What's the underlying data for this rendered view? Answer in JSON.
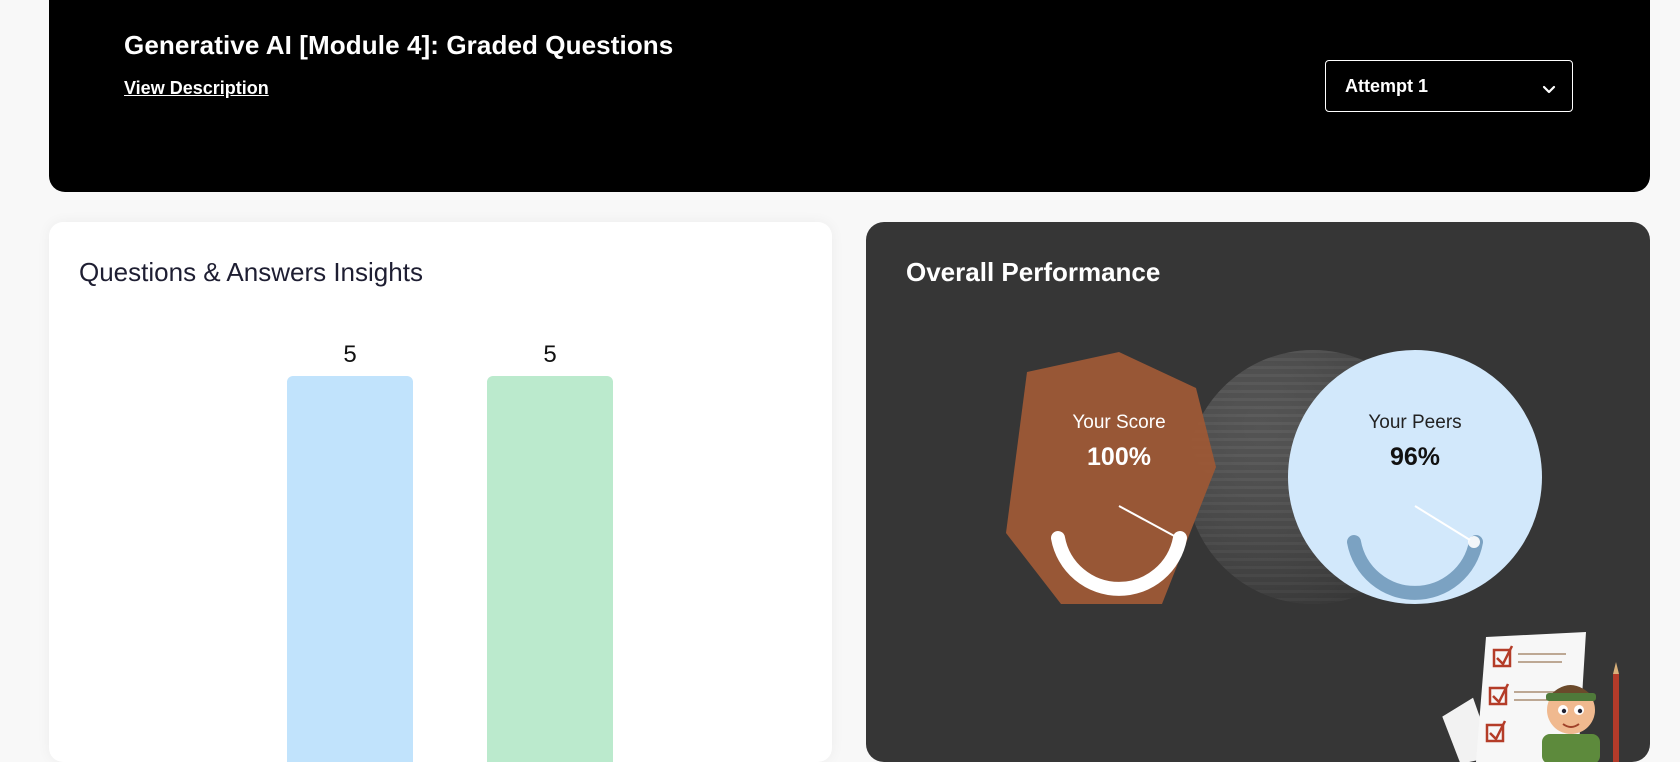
{
  "header": {
    "title": "Generative AI [Module 4]: Graded Questions",
    "view_description": "View Description",
    "attempt": {
      "selected": "Attempt 1",
      "icon": "chevron-down-icon"
    }
  },
  "insights": {
    "title": "Questions & Answers Insights",
    "chart_data": {
      "type": "bar",
      "title": "Questions & Answers Insights",
      "categories": [
        "",
        ""
      ],
      "values": [
        5,
        5
      ],
      "colors": [
        "#c1e3fc",
        "#bbeacd"
      ],
      "ylim": [
        0,
        5
      ],
      "grid": false
    }
  },
  "performance": {
    "title": "Overall Performance",
    "your_score": {
      "label": "Your Score",
      "value": "100%",
      "fraction": 1.0,
      "color": "#9a5836"
    },
    "your_peers": {
      "label": "Your Peers",
      "value": "96%",
      "fraction": 0.96,
      "color": "#d2e8fb"
    }
  }
}
